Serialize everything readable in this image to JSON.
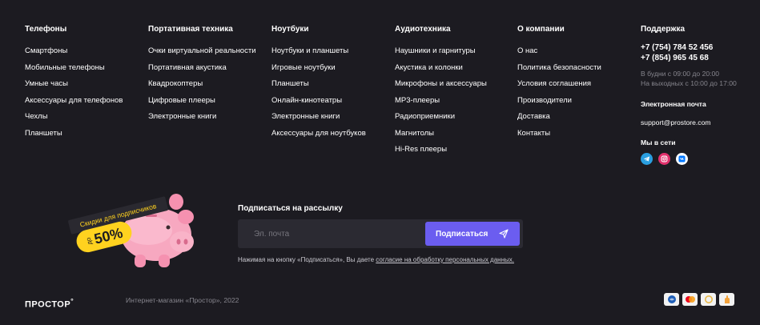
{
  "columns": [
    {
      "title": "Телефоны",
      "items": [
        "Смартфоны",
        "Мобильные телефоны",
        "Умные часы",
        "Аксессуары для телефонов",
        "Чехлы",
        "Планшеты"
      ]
    },
    {
      "title": "Портативная техника",
      "items": [
        "Очки виртуальной реальности",
        "Портативная акустика",
        "Квадрокоптеры",
        "Цифровые плееры",
        "Электронные книги"
      ]
    },
    {
      "title": "Ноутбуки",
      "items": [
        "Ноутбуки и планшеты",
        "Игровые ноутбуки",
        "Планшеты",
        "Онлайн-кинотеатры",
        "Электронные книги",
        "Аксессуары для ноутбуков"
      ]
    },
    {
      "title": "Аудиотехника",
      "items": [
        "Наушники и гарнитуры",
        "Акустика и колонки",
        "Микрофоны и аксессуары",
        "MP3-плееры",
        "Радиоприемники",
        "Магнитолы",
        "Hi-Res плееры"
      ]
    },
    {
      "title": "О компании",
      "items": [
        "О нас",
        "Политика безопасности",
        "Условия соглашения",
        "Производители",
        "Доставка",
        "Контакты"
      ]
    }
  ],
  "support": {
    "title": "Поддержка",
    "phone1": "+7 (754) 784 52 456",
    "phone2": "+7 (854) 965 45 68",
    "hours1": "В будни с 09:00 до 20:00",
    "hours2": "На выходных с 10:00 до 17:00",
    "email_title": "Электронная почта",
    "email": "support@prostore.com",
    "social_title": "Мы в сети",
    "socials": [
      "telegram-icon",
      "instagram-icon",
      "vk-icon"
    ]
  },
  "promo": {
    "ribbon": "Скидки для подписчиков",
    "prefix": "до",
    "percent": "50%"
  },
  "newsletter": {
    "title": "Подписаться на рассылку",
    "placeholder": "Эл. почта",
    "button": "Подписаться",
    "consent_text": "Нажимая на кнопку «Подписаться», Вы даете ",
    "consent_link": "согласие на обработку персональных данных."
  },
  "footer": {
    "logo": "ПРОСТОР",
    "copyright": "Интернет-магазин «Простор», 2022"
  },
  "payments": [
    "mir-icon",
    "mastercard-icon",
    "visa-icon",
    "cash-icon"
  ],
  "colors": {
    "background": "#1c1b21",
    "accent": "#6b5df0",
    "promo_yellow": "#ffd21f",
    "piggy": "#f7a8c0"
  }
}
